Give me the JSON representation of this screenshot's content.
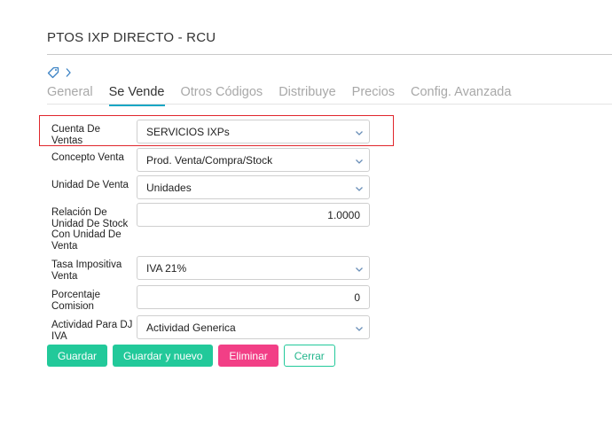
{
  "page": {
    "title": "PTOS IXP DIRECTO - RCU"
  },
  "breadcrumb": {
    "icon": "tag-icon",
    "separator": "chevron-right-icon"
  },
  "tabs": [
    {
      "label": "General"
    },
    {
      "label": "Se Vende"
    },
    {
      "label": "Otros Códigos"
    },
    {
      "label": "Distribuye"
    },
    {
      "label": "Precios"
    },
    {
      "label": "Config. Avanzada"
    }
  ],
  "active_tab": "Se Vende",
  "form": {
    "cuenta_ventas": {
      "label": "Cuenta De Ventas",
      "value": "SERVICIOS IXPs"
    },
    "concepto_venta": {
      "label": "Concepto Venta",
      "value": "Prod. Venta/Compra/Stock"
    },
    "unidad_venta": {
      "label": "Unidad De Venta",
      "value": "Unidades"
    },
    "relacion_unidad": {
      "label": "Relación De Unidad De Stock Con Unidad De Venta",
      "value": "1.0000"
    },
    "tasa_impositiva": {
      "label": "Tasa Impositiva Venta",
      "value": "IVA 21%"
    },
    "porcentaje_comision": {
      "label": "Porcentaje Comision",
      "value": "0"
    },
    "actividad_dj_iva": {
      "label": "Actividad Para DJ IVA",
      "value": "Actividad Generica"
    }
  },
  "buttons": {
    "guardar": "Guardar",
    "guardar_nuevo": "Guardar y nuevo",
    "eliminar": "Eliminar",
    "cerrar": "Cerrar"
  },
  "colors": {
    "accent_tab": "#1aa6c4",
    "btn_green": "#22c99a",
    "btn_pink": "#f23f86",
    "highlight": "#e0262c"
  }
}
